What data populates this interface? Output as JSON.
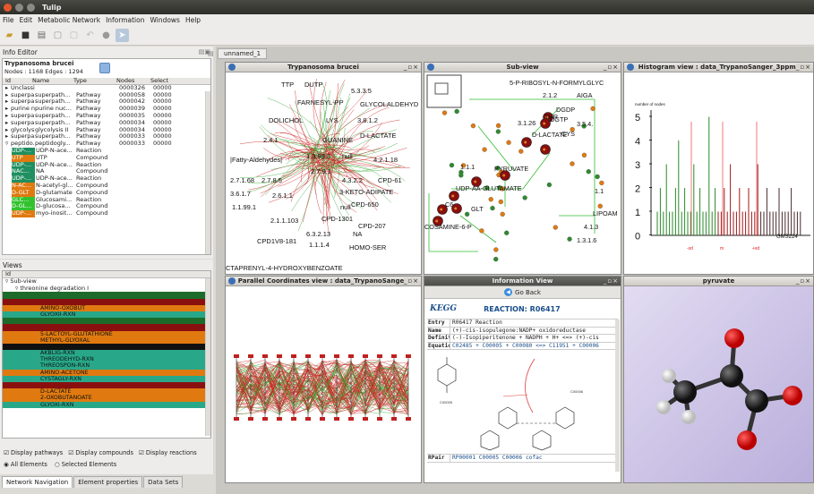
{
  "app": {
    "title": "Tulip"
  },
  "menu": [
    "File",
    "Edit",
    "Metabolic Network",
    "Information",
    "Windows",
    "Help"
  ],
  "info_editor": {
    "title": "Info Editor",
    "graph_name": "Trypanosoma brucei",
    "stats": "Nodes : 1168 Edges : 1294",
    "columns": [
      "Id",
      "Name",
      "Type",
      "Nodes",
      "Select"
    ],
    "rows": [
      {
        "id": "Unclassi...",
        "name": "",
        "type": "",
        "nodes": "0000326",
        "sel": "00000"
      },
      {
        "id": "superpa...",
        "name": "superpath...",
        "type": "Pathway",
        "nodes": "0000058",
        "sel": "00000"
      },
      {
        "id": "superpa...",
        "name": "superpath...",
        "type": "Pathway",
        "nodes": "0000042",
        "sel": "00000"
      },
      {
        "id": "purine n...",
        "name": "purine nuc...",
        "type": "Pathway",
        "nodes": "0000039",
        "sel": "00000"
      },
      {
        "id": "superpa...",
        "name": "superpath...",
        "type": "Pathway",
        "nodes": "0000035",
        "sel": "00000"
      },
      {
        "id": "superpa...",
        "name": "superpath...",
        "type": "Pathway",
        "nodes": "0000034",
        "sel": "00000"
      },
      {
        "id": "glycolysi...",
        "name": "glycolysis II",
        "type": "Pathway",
        "nodes": "0000034",
        "sel": "00000"
      },
      {
        "id": "superpa...",
        "name": "superpath...",
        "type": "Pathway",
        "nodes": "0000033",
        "sel": "00000"
      },
      {
        "id": "peptido...",
        "name": "peptidogly...",
        "type": "Pathway",
        "nodes": "0000033",
        "sel": "00000"
      }
    ],
    "sub_rows": [
      {
        "id": "UDP-...",
        "name": "UDP-N-ace...",
        "type": "Reaction",
        "color": "#1f8f5f"
      },
      {
        "id": "UTP",
        "name": "UTP",
        "type": "Compound",
        "color": "#e07a10"
      },
      {
        "id": "UDP-...",
        "name": "UDP-N-ace...",
        "type": "Reaction",
        "color": "#1f8f5f"
      },
      {
        "id": "NAC...",
        "name": "NA",
        "type": "Compound",
        "color": "#1f8f5f"
      },
      {
        "id": "UDP-...",
        "name": "UDP-N-ace...",
        "type": "Reaction",
        "color": "#1f8f5f"
      },
      {
        "id": "N-AC...",
        "name": "N-acetyl-gl...",
        "type": "Compound",
        "color": "#e07a10"
      },
      {
        "id": "D-GLT",
        "name": "D-glutamate",
        "type": "Compound",
        "color": "#e07a10"
      },
      {
        "id": "GLC...",
        "name": "Glucosami...",
        "type": "Reaction",
        "color": "#33c22f"
      },
      {
        "id": "D-GL...",
        "name": "D-glucosa...",
        "type": "Compound",
        "color": "#33c22f"
      },
      {
        "id": "UDP-...",
        "name": "myo-inosit...",
        "type": "Compound",
        "color": "#e07a10"
      }
    ]
  },
  "views": {
    "title": "Views",
    "col": "Id",
    "sub_view": "Sub-view",
    "group": "threonine degradation I",
    "items": [
      {
        "label": "",
        "color": "#1c6b2a"
      },
      {
        "label": "",
        "color": "#8a1010"
      },
      {
        "label": "AMINO-OXOBUT",
        "color": "#e07a10"
      },
      {
        "label": "GLYOXII-RXN",
        "color": "#28a889"
      },
      {
        "label": "",
        "color": "#1c6b2a"
      },
      {
        "label": "",
        "color": "#8a1010"
      },
      {
        "label": "5-LACTOYL-GLUTATHIONE",
        "color": "#e07a10"
      },
      {
        "label": "METHYL-GLYOXAL",
        "color": "#e07a10"
      },
      {
        "label": "",
        "color": "#111111"
      },
      {
        "label": "AKBLIG-RXN",
        "color": "#28a889"
      },
      {
        "label": "THREODEHYD-RXN",
        "color": "#28a889"
      },
      {
        "label": "THREOSPON-RXN",
        "color": "#28a889"
      },
      {
        "label": "AMINO-ACETONE",
        "color": "#e07a10"
      },
      {
        "label": "CYSTAGLY-RXN",
        "color": "#28a889"
      },
      {
        "label": "",
        "color": "#8a1010"
      },
      {
        "label": "D-LACTATE",
        "color": "#e07a10"
      },
      {
        "label": "2-OXOBUTANOATE",
        "color": "#e07a10"
      },
      {
        "label": "GLYOXI-RXN",
        "color": "#28a889"
      }
    ]
  },
  "options": {
    "display_pathways": "Display pathways",
    "display_compounds": "Display compounds",
    "display_reactions": "Display reactions",
    "all_elements": "All Elements",
    "selected_elements": "Selected Elements"
  },
  "bottom_tabs": [
    "Network Navigation",
    "Element properties",
    "Data Sets"
  ],
  "workspace_tab": "unnamed_1",
  "windows": {
    "w1": "Trypanosoma brucei",
    "w2": "Sub-view",
    "w3": "Histogram view : data_TrypanoSanger_3ppm.csv",
    "w4": "Parallel Coordinates view : data_TrypanoSanger_...",
    "w5": "Information View",
    "w6": "pyruvate"
  },
  "graph_labels": [
    "TTP",
    "DUTP",
    "5.3.3.5",
    "FARNESYL-PP",
    "GLYCOLALDEHYD",
    "DOLICHOL",
    "LYS",
    "3.8.1.2",
    "2.4.1",
    "GUANINE",
    "D-LACTATE",
    "|Fatty-Aldehydes|",
    "1.3.99.3",
    "null",
    "4.2.1.18",
    "2.7.1.68",
    "2.7.8.5",
    "2.7.9.1",
    "4.3.2.2",
    "CPD-61",
    "3.6.1.7",
    "2.6.1.1",
    "3-KETO-ADIPATE",
    "1.1.99.1",
    "null",
    "CPD-650",
    "2.1.1.103",
    "CPD-1301",
    "CPD-207",
    "6.3.2.13",
    "NA",
    "CPD1V8-181",
    "1.1.1.4",
    "HOMO-SER",
    "CTAPRENYL-4-HYDROXYBENZOATE"
  ],
  "subview_labels": [
    "5-P-RIBOSYL-N-FORMYLGLYC",
    "2.1.2",
    "AIGA",
    "DGDP",
    "THR",
    "DGTP",
    "3.5.4.",
    "3.1.26",
    "D-LACTATE",
    "CYS",
    "1.1.1",
    "PYRUVATE",
    "UDP-AA-GLUTAMATE",
    "1.1",
    "C6",
    "GLT",
    "LIPOAM",
    "COSAMINE-6-P",
    "4.1.3",
    "1.3.1.6"
  ],
  "histogram": {
    "y_label": "number of nodes",
    "y_ticks": [
      "5",
      "4",
      "3",
      "2",
      "1",
      "0"
    ],
    "x_label": "GMS224",
    "marks": [
      "-sd",
      "m",
      "+sd"
    ]
  },
  "info_view": {
    "go_back": "Go Back",
    "logo": "KEGG",
    "reaction": "REACTION: R06417",
    "rows": [
      {
        "k": "Entry",
        "v": "R06417                    Reaction"
      },
      {
        "k": "Name",
        "v": "(+)-cis-isopulegone:NADP+ oxidoreductase"
      },
      {
        "k": "Definition",
        "v": "(-)-Isopiperitenone + NADPH + H+ <=> (+)-cis"
      },
      {
        "k": "Equation",
        "v": "C02485 + C00005 + C00080 <=> C11951 + C00006"
      }
    ],
    "rpair_k": "RPair",
    "rpair_v": "RP00001  C00005 C00006 cofac",
    "cpd1": "C00005",
    "cpd2": "C00006"
  },
  "colors": {
    "reaction": "#28a889",
    "compound": "#e07a10",
    "edge_red": "#cc2222",
    "edge_green": "#33aa33"
  }
}
